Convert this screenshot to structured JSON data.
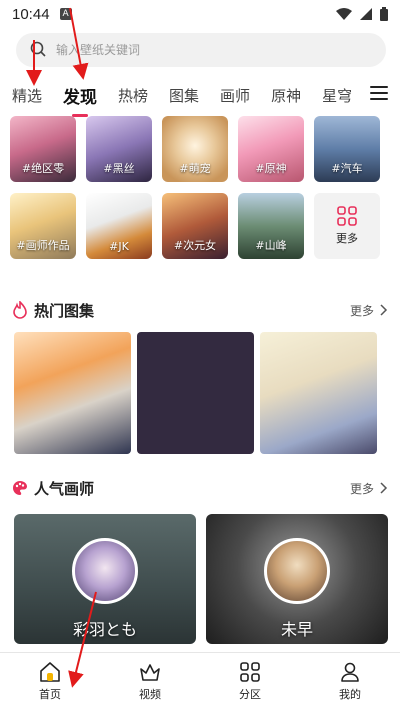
{
  "status": {
    "time": "10:44"
  },
  "search": {
    "placeholder": "输入壁纸关键词"
  },
  "tabs": [
    "精选",
    "发现",
    "热榜",
    "图集",
    "画师",
    "原神",
    "星穹"
  ],
  "categories": [
    "#绝区零",
    "#黑丝",
    "#萌宠",
    "#原神",
    "#汽车",
    "#画师作品",
    "#JK",
    "#次元女",
    "#山峰",
    "更多"
  ],
  "sections": {
    "hot": {
      "title": "热门图集",
      "more": "更多"
    },
    "artists": {
      "title": "人气画师",
      "more": "更多"
    }
  },
  "artists": [
    {
      "name": "彩羽とも"
    },
    {
      "name": "未早"
    }
  ],
  "nav": [
    "首页",
    "视频",
    "分区",
    "我的"
  ],
  "colors": {
    "accent": "#e8305a",
    "nav_active": "#f4b400"
  }
}
